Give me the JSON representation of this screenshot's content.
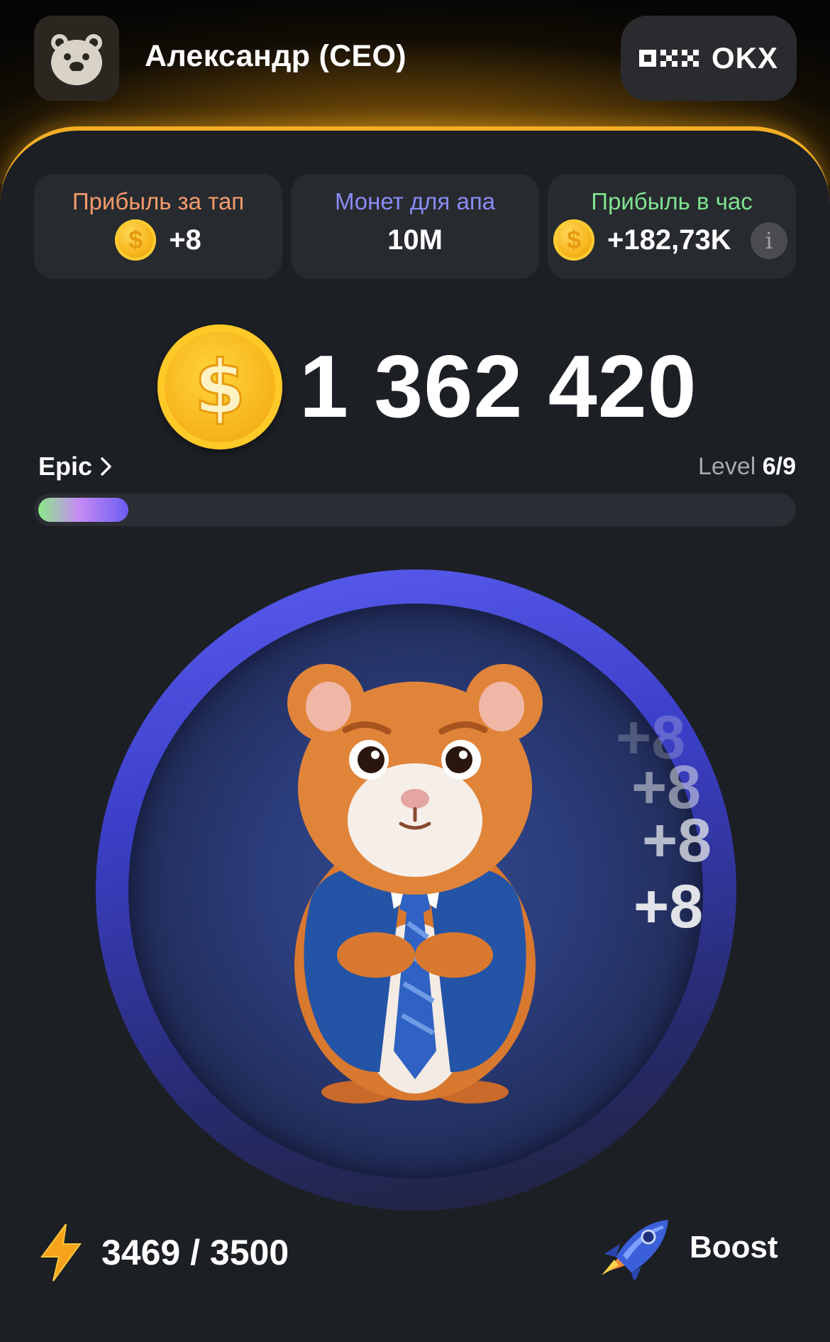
{
  "header": {
    "username": "Александр (CEO)",
    "exchange_label": "OKX"
  },
  "stats": [
    {
      "title": "Прибыль за тап",
      "value": "+8",
      "title_color": "#f59b6b",
      "icon": "coin-icon"
    },
    {
      "title": "Монет для апа",
      "value": "10M",
      "title_color": "#8a8cf5"
    },
    {
      "title": "Прибыль в час",
      "value": "+182,73K",
      "title_color": "#7ee38f",
      "icon": "coin-icon",
      "extra_icon": "info-icon"
    }
  ],
  "balance": {
    "value": "1 362 420"
  },
  "league": {
    "name": "Epic",
    "level_label": "Level",
    "level_value": "6/9",
    "progress": 0.12
  },
  "tap_popups": [
    "+8",
    "+8",
    "+8",
    "+8"
  ],
  "energy": {
    "value": "3469 / 3500"
  },
  "boost": {
    "label": "Boost"
  },
  "colors": {
    "accent": "#f4ae24",
    "panel": "#1c1f24",
    "card": "#272a2f"
  }
}
